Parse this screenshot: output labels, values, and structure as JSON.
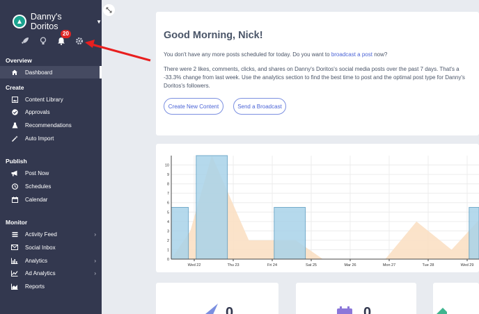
{
  "sidebar": {
    "brand_name": "Danny's Doritos",
    "notification_count": "20",
    "sections": {
      "overview": "Overview",
      "create": "Create",
      "publish": "Publish",
      "monitor": "Monitor"
    },
    "items": {
      "dashboard": "Dashboard",
      "content_library": "Content Library",
      "approvals": "Approvals",
      "recommendations": "Recommendations",
      "auto_import": "Auto Import",
      "post_now": "Post Now",
      "schedules": "Schedules",
      "calendar": "Calendar",
      "activity_feed": "Activity Feed",
      "social_inbox": "Social Inbox",
      "analytics": "Analytics",
      "ad_analytics": "Ad Analytics",
      "reports": "Reports"
    }
  },
  "greeting": {
    "title": "Good Morning, Nick!",
    "line1_before": "You don't have any more posts scheduled for today. Do you want to",
    "line1_link": "broadcast a post",
    "line1_after": "now?",
    "line2": "There were 2 likes, comments, clicks, and shares on Danny's Doritos's social media posts over the past 7 days. That's a",
    "line3": "-33.3% change from last week. Use the analytics section to find the best time to post and the optimal post type for Danny's",
    "line4": "Doritos's followers.",
    "create_button": "Create New Content",
    "broadcast_button": "Send a Broadcast"
  },
  "chart_data": {
    "type": "bar",
    "categories": [
      "Wed 22",
      "Thu 23",
      "Fri 24",
      "Sat 25",
      "Mar 26",
      "Mon 27",
      "Tue 28",
      "Wed 29"
    ],
    "y_ticks": [
      "0",
      "1",
      "2",
      "3",
      "4",
      "5",
      "6",
      "7",
      "8",
      "9",
      "10"
    ],
    "ylim": [
      0,
      11
    ],
    "bar_color": "#a9d3e9",
    "area_color": "#fbe0c4",
    "bars": [
      {
        "x0": -0.6,
        "x1": -0.15,
        "value": 5.5
      },
      {
        "x0": 0.05,
        "x1": 0.85,
        "value": 11
      },
      {
        "x0": 2.05,
        "x1": 2.85,
        "value": 5.5
      },
      {
        "x0": 7.05,
        "x1": 7.6,
        "value": 5.5
      }
    ],
    "line_points": [
      [
        -0.6,
        0
      ],
      [
        -0.1,
        3
      ],
      [
        0.45,
        11
      ],
      [
        1.4,
        2
      ],
      [
        2.6,
        2
      ],
      [
        3.3,
        0
      ],
      [
        4.9,
        0
      ],
      [
        5.7,
        4
      ],
      [
        6.6,
        1
      ],
      [
        7.6,
        5.5
      ]
    ]
  },
  "stats": {
    "card1_value": "0",
    "card2_value": "0"
  }
}
